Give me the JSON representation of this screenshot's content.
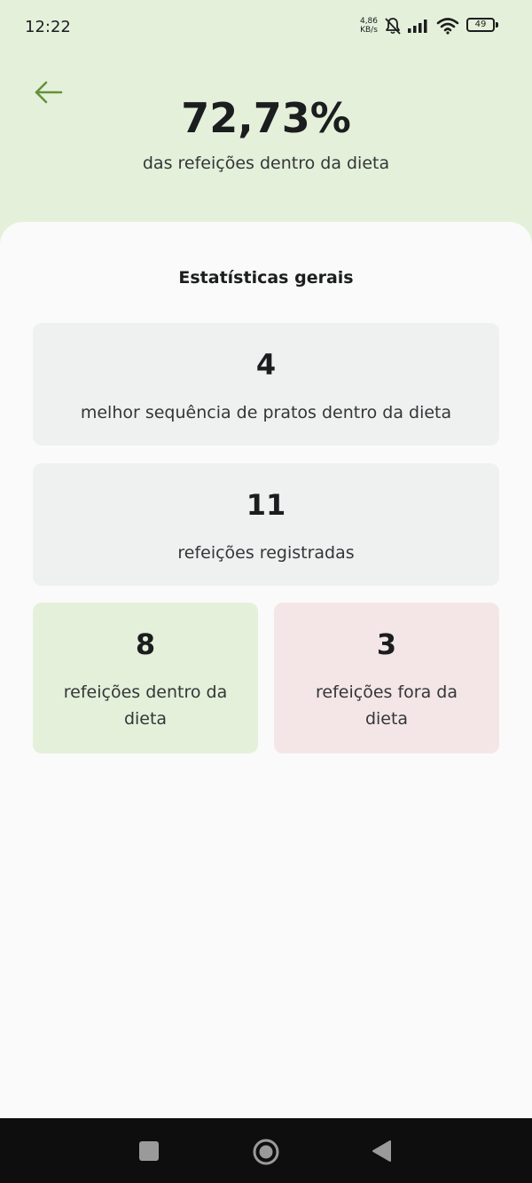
{
  "status_bar": {
    "time": "12:22",
    "network_speed_value": "4,86",
    "network_speed_unit": "KB/s",
    "battery_level": "49",
    "icons": [
      "notifications-muted-icon",
      "cellular-signal-icon",
      "wifi-icon",
      "battery-icon"
    ]
  },
  "header": {
    "back_icon": "arrow-left-icon",
    "percent": "72,73%",
    "subtitle": "das refeições dentro da dieta",
    "accent_color": "#639339",
    "background_color": "#e5f0db"
  },
  "statistics": {
    "title": "Estatísticas gerais",
    "best_sequence": {
      "value": "4",
      "label": "melhor sequência de pratos dentro da dieta"
    },
    "registered_meals": {
      "value": "11",
      "label": "refeições registradas"
    },
    "meals_within_diet": {
      "value": "8",
      "label": "refeições dentro da dieta",
      "color": "#e5f0db"
    },
    "meals_outside_diet": {
      "value": "3",
      "label": "refeições fora da dieta",
      "color": "#f4e6e7"
    }
  },
  "nav_bar": {
    "buttons": [
      "recents-square-icon",
      "home-circle-icon",
      "back-triangle-icon"
    ]
  }
}
